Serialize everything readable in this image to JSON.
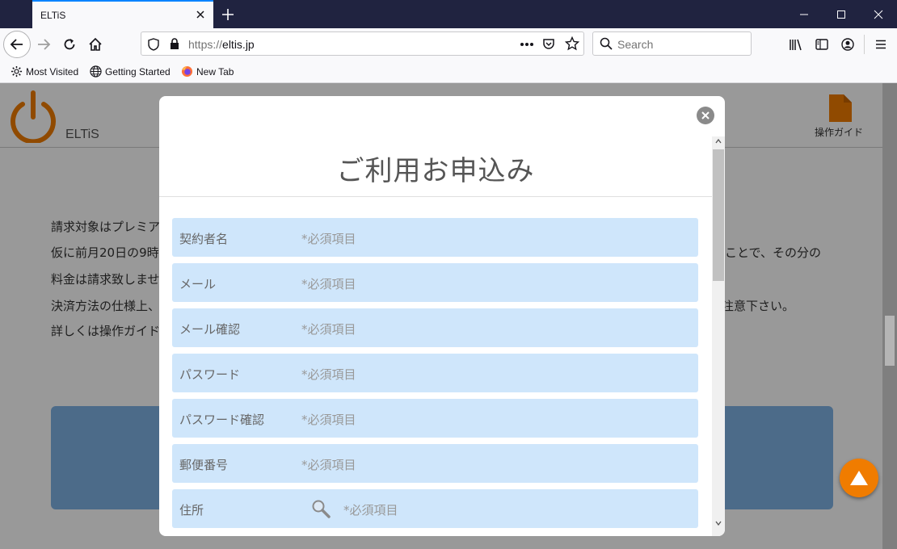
{
  "browser": {
    "tab_title": "ELTiS",
    "url_prefix": "https://",
    "url_domain": "eltis.jp",
    "search_placeholder": "Search",
    "bookmarks": [
      "Most Visited",
      "Getting Started",
      "New Tab"
    ]
  },
  "page": {
    "brand": "ELTiS",
    "guide_label": "操作ガイド",
    "lines": [
      "請求対象はプレミア",
      "仮に前月20日の9時",
      "料金は請求致しませ",
      "決済方法の仕様上、",
      "詳しくは操作ガイド"
    ],
    "lines_right": [
      "ことで、その分の",
      "注意下さい。"
    ],
    "colors": {
      "accent": "#f07c00",
      "brand_blue": "#7fb2e5"
    }
  },
  "modal": {
    "title": "ご利用お申込み",
    "required_placeholder": "*必須項目",
    "fields": [
      {
        "label": "契約者名"
      },
      {
        "label": "メール"
      },
      {
        "label": "メール確認"
      },
      {
        "label": "パスワード"
      },
      {
        "label": "パスワード確認"
      },
      {
        "label": "郵便番号"
      },
      {
        "label": "住所"
      }
    ]
  }
}
